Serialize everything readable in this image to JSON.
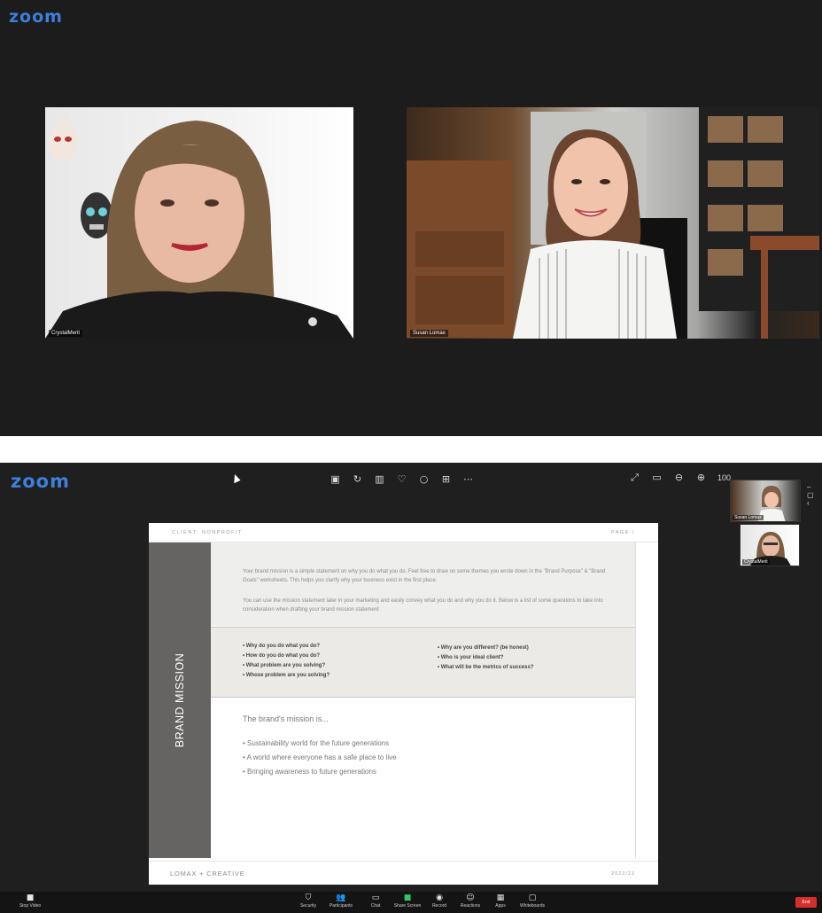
{
  "top_window": {
    "logo": "zoom",
    "participants": [
      {
        "label": "CrystalMerit"
      },
      {
        "label": "Susan Lomax"
      }
    ]
  },
  "bottom_window": {
    "logo": "zoom",
    "annotation_tools": [
      "note-icon",
      "rotate-icon",
      "trash-icon",
      "heart-icon",
      "circle-icon",
      "grid-icon",
      "more-icon"
    ],
    "view_tools": {
      "zoom_level": "100"
    },
    "thumbnails": [
      {
        "label": "Susan Lomax"
      },
      {
        "label": "CrystalMerit"
      }
    ],
    "thumb_controls": "– ▢ ‹",
    "document": {
      "client": "CLIENT: NONPROFIT",
      "page": "PAGE /",
      "side_title": "BRAND MISSION",
      "intro_p1": "Your brand mission is a simple statement on why you do what you do. Feel free to draw on some themes you wrote down in the \"Brand Purpose\" & \"Brand Goals\" worksheets. This helps you clarify why your business exist in the first place.",
      "intro_p2": "You can use the mission statement later in your marketing and easily convey what you do and why you do it. Below is a list of some questions to take into consideration when drafting your brand mission statement",
      "questions_left": [
        "• Why do you do what you do?",
        "• How do you do what you do?",
        "• What problem are you solving?",
        "• Whose problem are you solving?"
      ],
      "questions_right": [
        "• Why are you different? (be honest)",
        "• Who is your ideal client?",
        "• What will be the metrics of success?"
      ],
      "mission_title": "The brand's mission is...",
      "mission_items": [
        "• Sustainability world for the future generations",
        "• A world where everyone has a safe place to live",
        "• Bringing awareness to future generations"
      ],
      "brand": "LOMAX + CREATIVE",
      "year": "2022/23"
    },
    "toolbar": {
      "items": [
        {
          "label": "Stop Video"
        },
        {
          "label": "Security"
        },
        {
          "label": "Participants"
        },
        {
          "label": "Chat"
        },
        {
          "label": "Share Screen"
        },
        {
          "label": "Record"
        },
        {
          "label": "Reactions"
        },
        {
          "label": "Apps"
        },
        {
          "label": "Whiteboards"
        }
      ],
      "end": "End"
    }
  },
  "colors": {
    "zoom_blue": "#3d7fd9",
    "share_green": "#2fc964",
    "end_red": "#d62e2e"
  }
}
